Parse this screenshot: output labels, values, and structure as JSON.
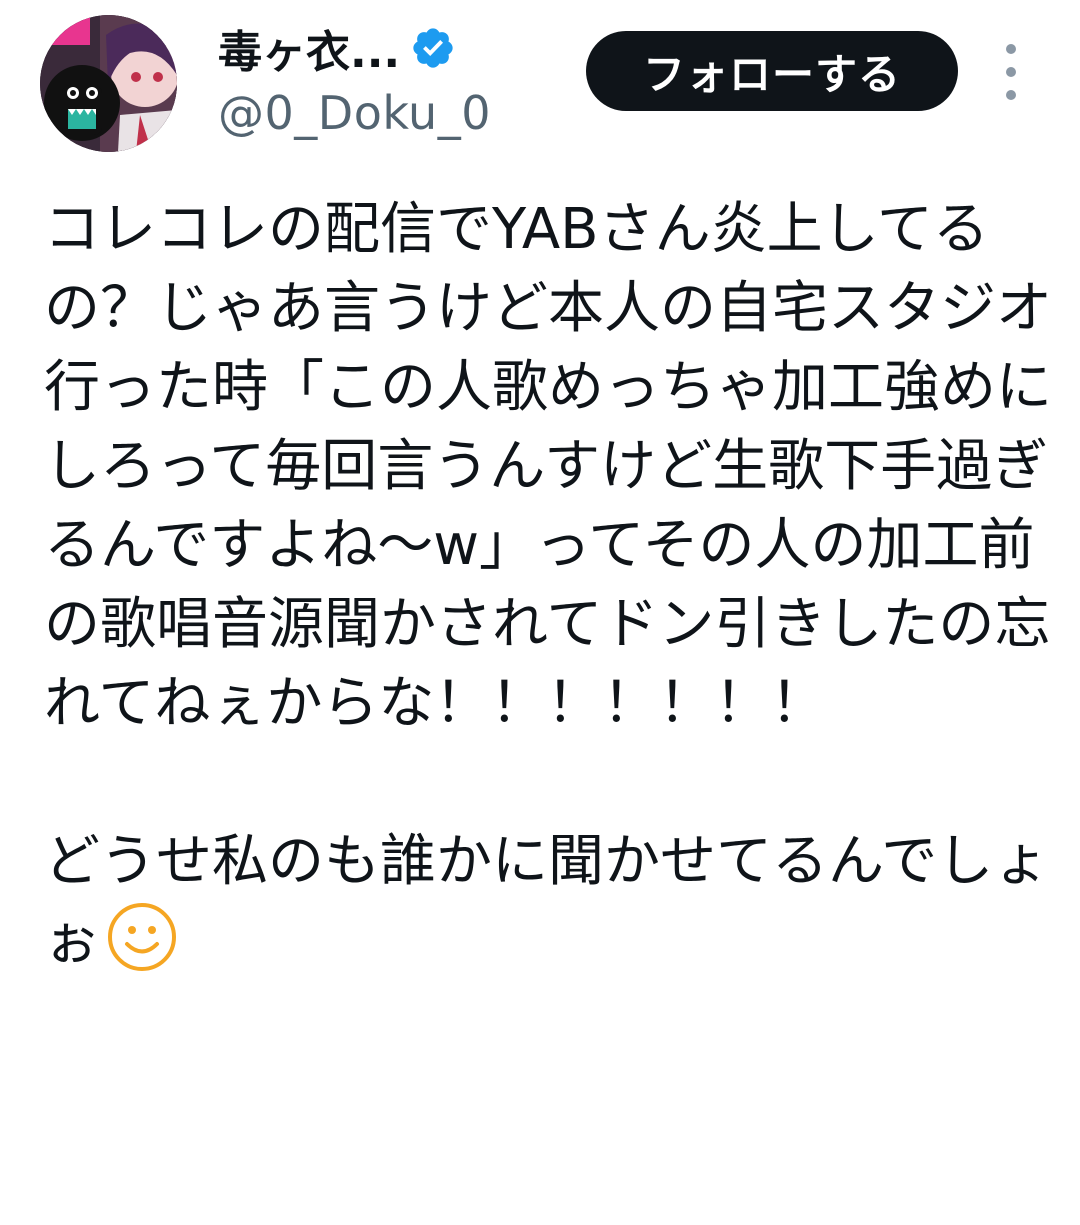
{
  "author": {
    "display_name": "毒ヶ衣...",
    "handle": "@0_Doku_0",
    "verified": true,
    "avatar_icon": "avatar-image"
  },
  "actions": {
    "follow_label": "フォローする",
    "more_icon": "more-vertical-icon"
  },
  "tweet": {
    "paragraph1": "コレコレの配信でYABさん炎上してるの？じゃあ言うけど本人の自宅スタジオ行った時「この人歌めっちゃ加工強めにしろって毎回言うんすけど生歌下手過ぎるんですよね〜w」ってその人の加工前の歌唱音源聞かされてドン引きしたの忘れてねぇからな！！！！！！！",
    "paragraph2": "どうせ私のも誰かに聞かせてるんでしょぉ",
    "emoji": "smiley-face-icon"
  },
  "colors": {
    "text": "#0f1419",
    "secondary": "#536471",
    "verified_blue": "#1d9bf0",
    "button_bg": "#0f1419",
    "emoji_orange": "#f5a623"
  }
}
